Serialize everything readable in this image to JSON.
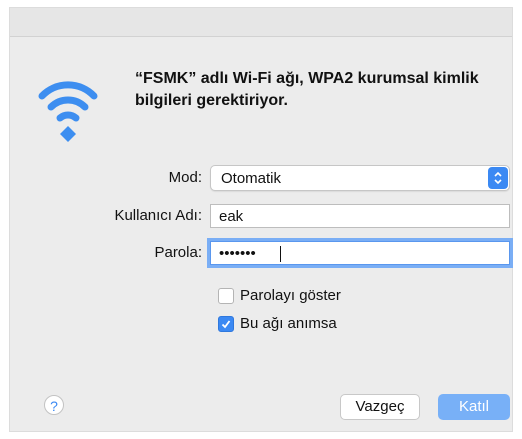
{
  "dialog": {
    "message_line1": "“FSMK” adlı Wi-Fi ağı, WPA2 kurumsal kimlik",
    "message_line2": "bilgileri gerektiriyor.",
    "icon": "wifi-icon"
  },
  "form": {
    "mode_label": "Mod:",
    "mode_value": "Otomatik",
    "username_label": "Kullanıcı Adı:",
    "username_value": "eak",
    "password_label": "Parola:",
    "password_value": "•••••••"
  },
  "options": {
    "show_password_label": "Parolayı göster",
    "show_password_checked": false,
    "remember_label": "Bu ağı anımsa",
    "remember_checked": true
  },
  "buttons": {
    "help": "?",
    "cancel": "Vazgeç",
    "join": "Katıl"
  },
  "colors": {
    "accent": "#3b89f3",
    "join_button": "#78b0f7"
  }
}
